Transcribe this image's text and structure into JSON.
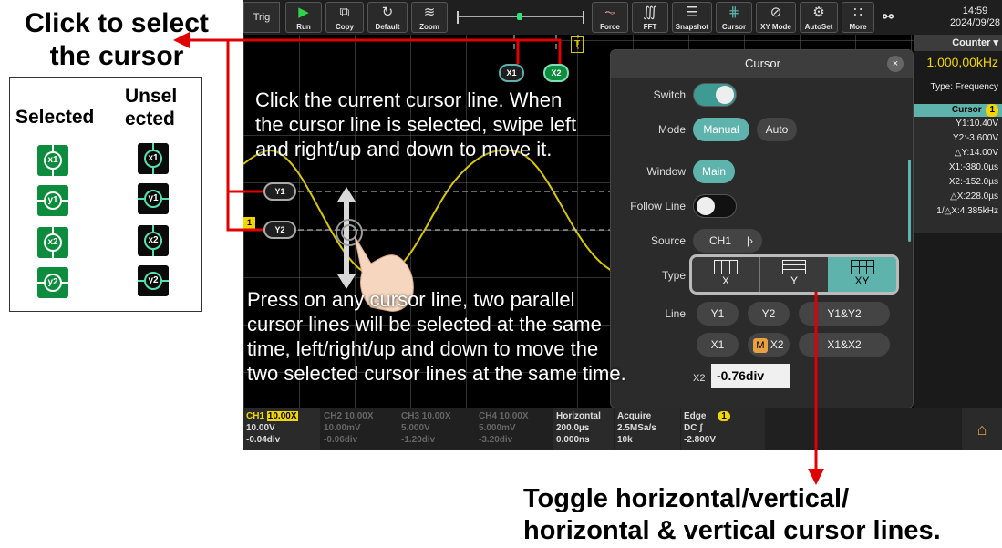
{
  "annotations": {
    "top_left": "Click to select\nthe cursor",
    "top_left_line1": "Click to select",
    "top_left_line2": "the cursor",
    "bottom_right_line1": "Toggle horizontal/vertical/",
    "bottom_right_line2": "horizontal & vertical cursor lines.",
    "legend_selected": "Selected",
    "legend_unselected_1": "Unsel",
    "legend_unselected_2": "ected",
    "legend_items": [
      "x1",
      "y1",
      "x2",
      "y2"
    ]
  },
  "overlay": {
    "instruction1_l1": "Click the current cursor line. When",
    "instruction1_l2": "the cursor line is selected, swipe left",
    "instruction1_l3": "and right/up and down to move it.",
    "instruction2_l1": "Press on any cursor line, two parallel",
    "instruction2_l2": "cursor lines will be selected at the same",
    "instruction2_l3": "time, left/right/up and down to move the",
    "instruction2_l4": "two selected cursor lines at the same time."
  },
  "toolbar": {
    "trig": "Trig",
    "run": "Run",
    "copy": "Copy",
    "default": "Default",
    "zoom": "Zoom",
    "force": "Force",
    "fft": "FFT",
    "snapshot": "Snapshot",
    "cursor": "Cursor",
    "xymode": "XY Mode",
    "autoset": "AutoSet",
    "more": "More",
    "time": "14:59",
    "date": "2024/09/28"
  },
  "markers": {
    "x1": "X1",
    "x2": "X2",
    "y1": "Y1",
    "y2": "Y2",
    "t": "T",
    "ch1": "1"
  },
  "panel": {
    "title": "Cursor",
    "switch_label": "Switch",
    "mode_label": "Mode",
    "mode_manual": "Manual",
    "mode_auto": "Auto",
    "window_label": "Window",
    "window_main": "Main",
    "follow_label": "Follow Line",
    "source_label": "Source",
    "source_value": "CH1",
    "type_label": "Type",
    "type_x": "X",
    "type_y": "Y",
    "type_xy": "XY",
    "line_label": "Line",
    "line_y1": "Y1",
    "line_y2": "Y2",
    "line_y1y2": "Y1&Y2",
    "line_x1": "X1",
    "line_x2": "X2",
    "line_x1x2": "X1&X2",
    "m_badge": "M",
    "x2_label": "X2",
    "x2_value": "-0.76div"
  },
  "side": {
    "counter": "Counter",
    "freq": "1.000,00kHz",
    "type": "Type: Frequency",
    "cursor_title": "Cursor",
    "cursor_badge": "1",
    "readings": [
      "Y1:10.40V",
      "Y2:-3.600V",
      "△Y:14.00V",
      "X1:-380.0µs",
      "X2:-152.0µs",
      "△X:228.0µs",
      "1/△X:4.385kHz"
    ]
  },
  "status": {
    "ch1": "CH1",
    "ch1_probe": "10.00X",
    "ch1_v": "10.00V",
    "ch1_off": "-0.04div",
    "ch2": "CH2",
    "ch2_probe": "10.00X",
    "ch2_v": "10.00mV",
    "ch2_off": "-0.06div",
    "ch3": "CH3",
    "ch3_probe": "10.00X",
    "ch3_v": "5.000V",
    "ch3_off": "-1.20div",
    "ch4": "CH4",
    "ch4_probe": "10.00X",
    "ch4_v": "5.000mV",
    "ch4_off": "-3.20div",
    "horizontal": "Horizontal",
    "h_time": "200.0µs",
    "h_off": "0.000ns",
    "acquire": "Acquire",
    "a_rate": "2.5MSa/s",
    "a_depth": "10k",
    "edge": "Edge",
    "edge_badge": "1",
    "edge_coupling": "DC",
    "edge_level": "-2.800V"
  },
  "colors": {
    "accent": "#5fb3ad",
    "yellow": "#f2d600",
    "red": "#e00000",
    "green": "#0c8c3c"
  }
}
